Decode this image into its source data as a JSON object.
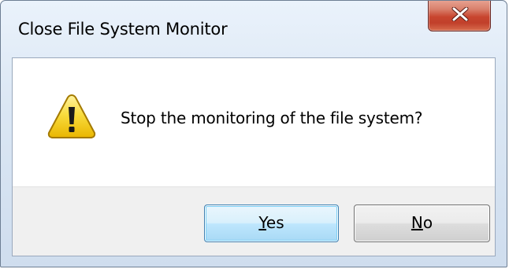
{
  "window": {
    "title": "Close File System Monitor",
    "close_icon": "close-x-icon"
  },
  "dialog": {
    "icon": "warning-icon",
    "message": "Stop the monitoring of the file system?"
  },
  "buttons": {
    "yes": {
      "mnemonic": "Y",
      "rest": "es"
    },
    "no": {
      "mnemonic": "N",
      "rest": "o"
    }
  },
  "colors": {
    "close_button": "#c8452f",
    "default_button_border": "#3c7fb1",
    "warning_yellow": "#f6d02c"
  }
}
